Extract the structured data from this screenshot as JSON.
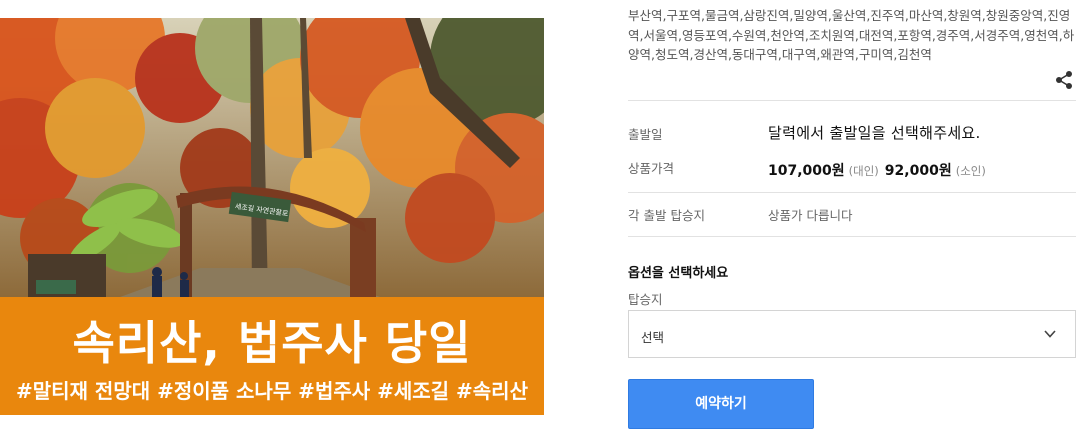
{
  "hero": {
    "sign_text": "세조길 자연관찰로",
    "banner_title": "속리산, 법주사 당일",
    "banner_tags": "#말티재 전망대 #정이품 소나무 #법주사 #세조길 #속리산",
    "banner_color": "#e9870d"
  },
  "stations_text": "부산역,구포역,물금역,삼랑진역,밀양역,울산역,진주역,마산역,창원역,창원중앙역,진영역,서울역,영등포역,수원역,천안역,조치원역,대전역,포항역,경주역,서경주역,영천역,하양역,청도역,경산역,동대구역,대구역,왜관역,구미역,김천역",
  "share_icon": "share-icon",
  "departure": {
    "label": "출발일",
    "value": "달력에서 출발일을 선택해주세요."
  },
  "price": {
    "label": "상품가격",
    "adult_price": "107,000원",
    "adult_unit": "(대인)",
    "child_price": "92,000원",
    "child_unit": "(소인)"
  },
  "boarding": {
    "label": "각 출발 탑승지",
    "value": "상품가 다릅니다"
  },
  "options": {
    "title": "옵션을 선택하세요",
    "field_label": "탑승지",
    "selected": "선택"
  },
  "book_button": "예약하기",
  "colors": {
    "accent": "#3f8bf2",
    "banner": "#e9870d"
  }
}
